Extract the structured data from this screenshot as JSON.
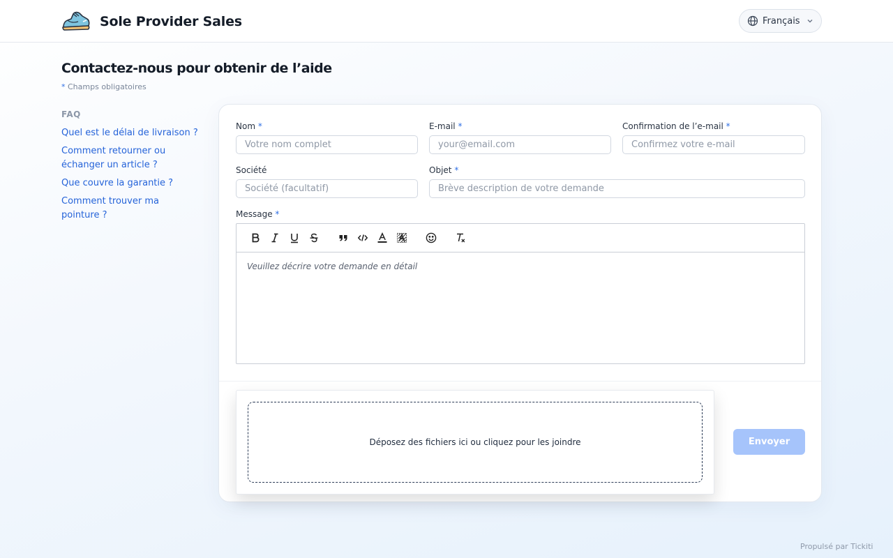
{
  "header": {
    "brand_name": "Sole Provider Sales",
    "language_label": "Français"
  },
  "page": {
    "title": "Contactez-nous pour obtenir de l’aide",
    "required_star": "*",
    "required_note": "Champs obligatoires"
  },
  "faq": {
    "heading": "FAQ",
    "items": [
      {
        "label": "Quel est le délai de livraison ?"
      },
      {
        "label": "Comment retourner ou échanger un article ?"
      },
      {
        "label": "Que couvre la garantie ?"
      },
      {
        "label": "Comment trouver ma pointure ?"
      }
    ]
  },
  "form": {
    "required_mark": "*",
    "name": {
      "label": "Nom",
      "placeholder": "Votre nom complet",
      "value": ""
    },
    "email": {
      "label": "E-mail",
      "placeholder": "your@email.com",
      "value": ""
    },
    "email_confirm": {
      "label": "Confirmation de l’e-mail",
      "placeholder": "Confirmez votre e-mail",
      "value": ""
    },
    "company": {
      "label": "Société",
      "placeholder": "Société (facultatif)",
      "value": ""
    },
    "subject": {
      "label": "Objet",
      "placeholder": "Brève description de votre demande",
      "value": ""
    },
    "message": {
      "label": "Message",
      "placeholder": "Veuillez décrire votre demande en détail"
    },
    "dropzone_text": "Déposez des fichiers ici ou cliquez pour les joindre",
    "submit_label": "Envoyer"
  },
  "toolbar": {
    "icons": [
      "bold-icon",
      "italic-icon",
      "underline-icon",
      "strikethrough-icon",
      "quote-icon",
      "code-icon",
      "text-color-icon",
      "highlight-icon",
      "emoji-icon",
      "clear-format-icon"
    ]
  },
  "colors": {
    "accent": "#2563d9",
    "required": "#2f6fe4",
    "submit_disabled": "#a6c4fb"
  },
  "footer": {
    "powered_by": "Propulsé par Tickiti"
  }
}
